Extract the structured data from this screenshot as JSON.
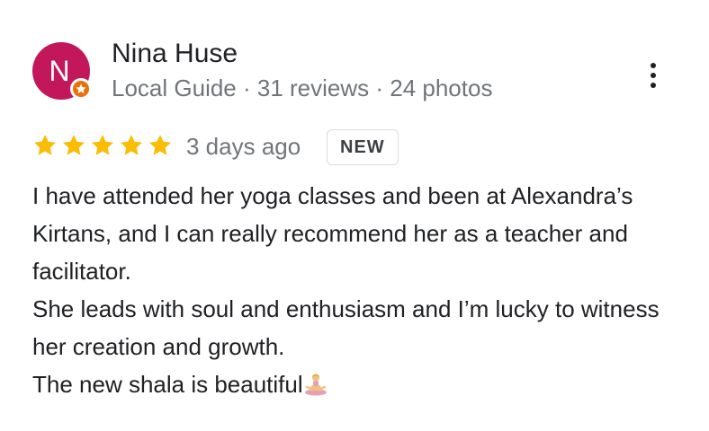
{
  "review": {
    "author": {
      "initial": "N",
      "name": "Nina Huse",
      "meta": "Local Guide · 31 reviews · 24 photos",
      "avatar_color": "#c2185b",
      "badge_color": "#e8710a",
      "badge_icon": "local-guide-star-icon"
    },
    "rating": 5,
    "star_color": "#fbbc04",
    "date": "3 days ago",
    "badge": "NEW",
    "text_lines": [
      "I have attended her yoga classes and been at Alexandra’s Kirtans, and I can really recommend her as a teacher and facilitator.",
      "She leads with soul and enthusiasm and I’m lucky to witness her creation and growth.",
      "The new shala is beautiful"
    ],
    "trailing_emoji": "woman-in-lotus-position-emoji",
    "menu_icon": "more-vert-icon"
  }
}
